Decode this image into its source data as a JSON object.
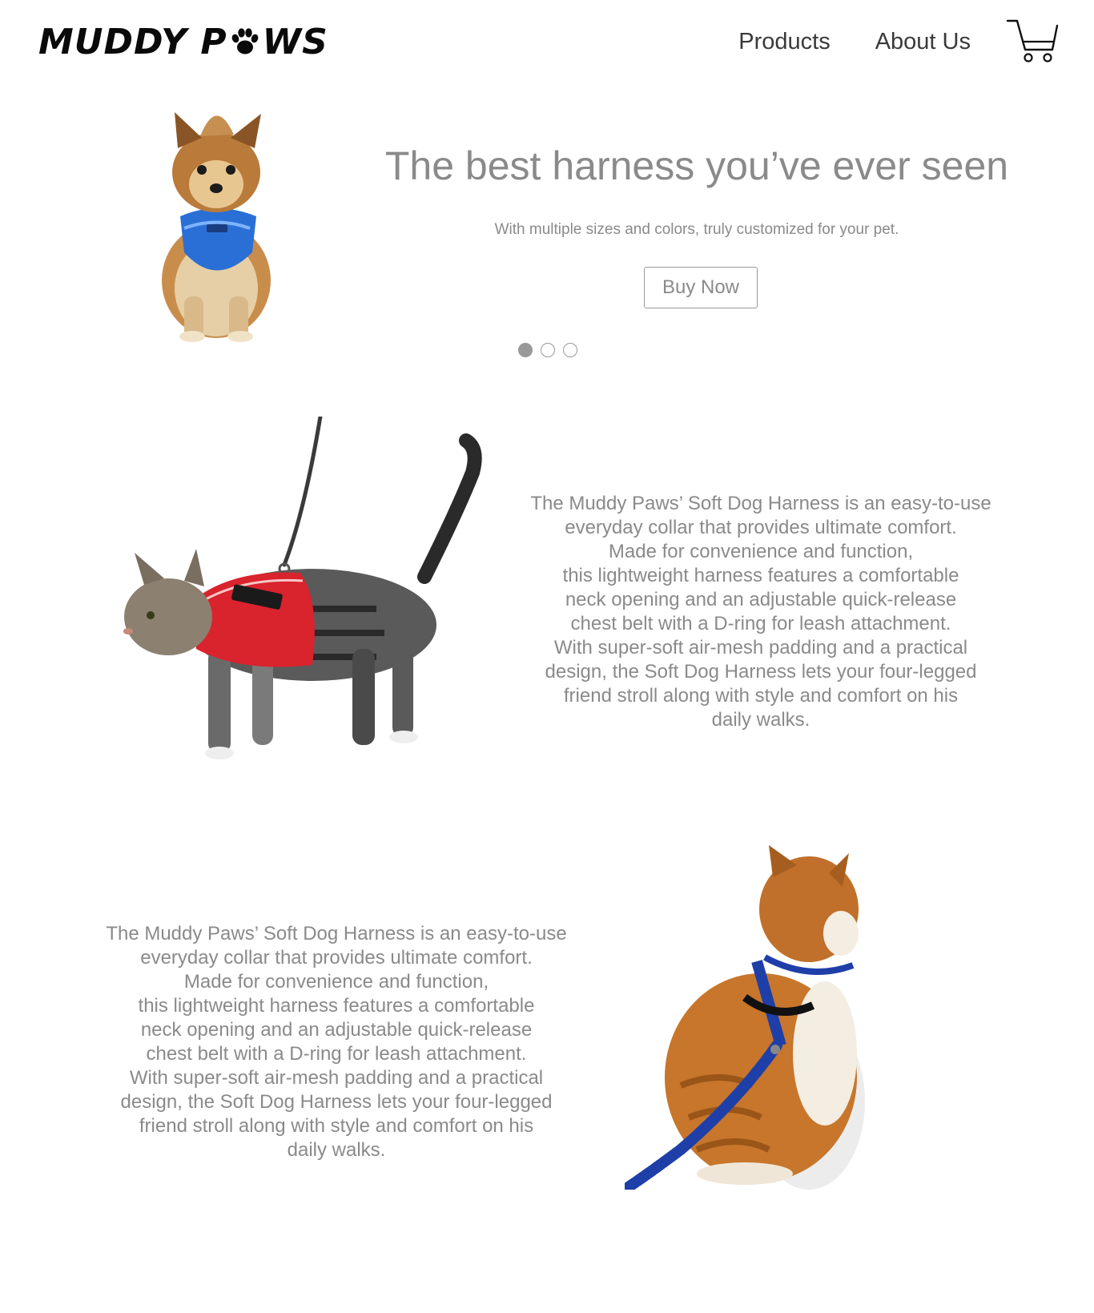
{
  "header": {
    "logo": {
      "text_left": "MUDDY P",
      "text_right": "WS",
      "icon": "paw-icon"
    },
    "nav": [
      {
        "label": "Products"
      },
      {
        "label": "About Us"
      }
    ],
    "cart_icon": "cart-icon"
  },
  "hero": {
    "title": "The best harness you’ve ever seen",
    "subtitle": "With multiple sizes and colors, truly customized for your pet.",
    "button_label": "Buy Now",
    "image_icon": "dog-harness-image",
    "slides_count": 3,
    "active_slide": 0
  },
  "features": [
    {
      "image_icon": "cat-red-harness-image",
      "lines": [
        "The Muddy Paws’ Soft Dog Harness is an easy-to-use",
        "everyday collar that provides ultimate comfort.",
        "Made for convenience and function,",
        "this lightweight harness features a comfortable",
        "neck opening and an adjustable quick-release",
        "chest belt with a D-ring for leash attachment.",
        "With super-soft air-mesh padding and a practical",
        "design, the Soft Dog Harness lets your four-legged",
        "friend stroll along with style and comfort on his",
        "daily walks."
      ]
    },
    {
      "image_icon": "cat-blue-leash-image",
      "lines": [
        "The Muddy Paws’ Soft Dog Harness is an easy-to-use",
        "everyday collar that provides ultimate comfort.",
        "Made for convenience and function,",
        "this lightweight harness features a comfortable",
        "neck opening and an adjustable quick-release",
        "chest belt with a D-ring for leash attachment.",
        "With super-soft air-mesh padding and a practical",
        "design, the Soft Dog Harness lets your four-legged",
        "friend stroll along with style and comfort on his",
        "daily walks."
      ]
    }
  ],
  "colors": {
    "text_gray": "#8a8a8a",
    "nav_text": "#3a3a3a",
    "harness_blue": "#2a6fd6",
    "harness_red": "#d9232d",
    "leash_blue": "#1f3fa8",
    "fur_orange": "#c7762b"
  }
}
